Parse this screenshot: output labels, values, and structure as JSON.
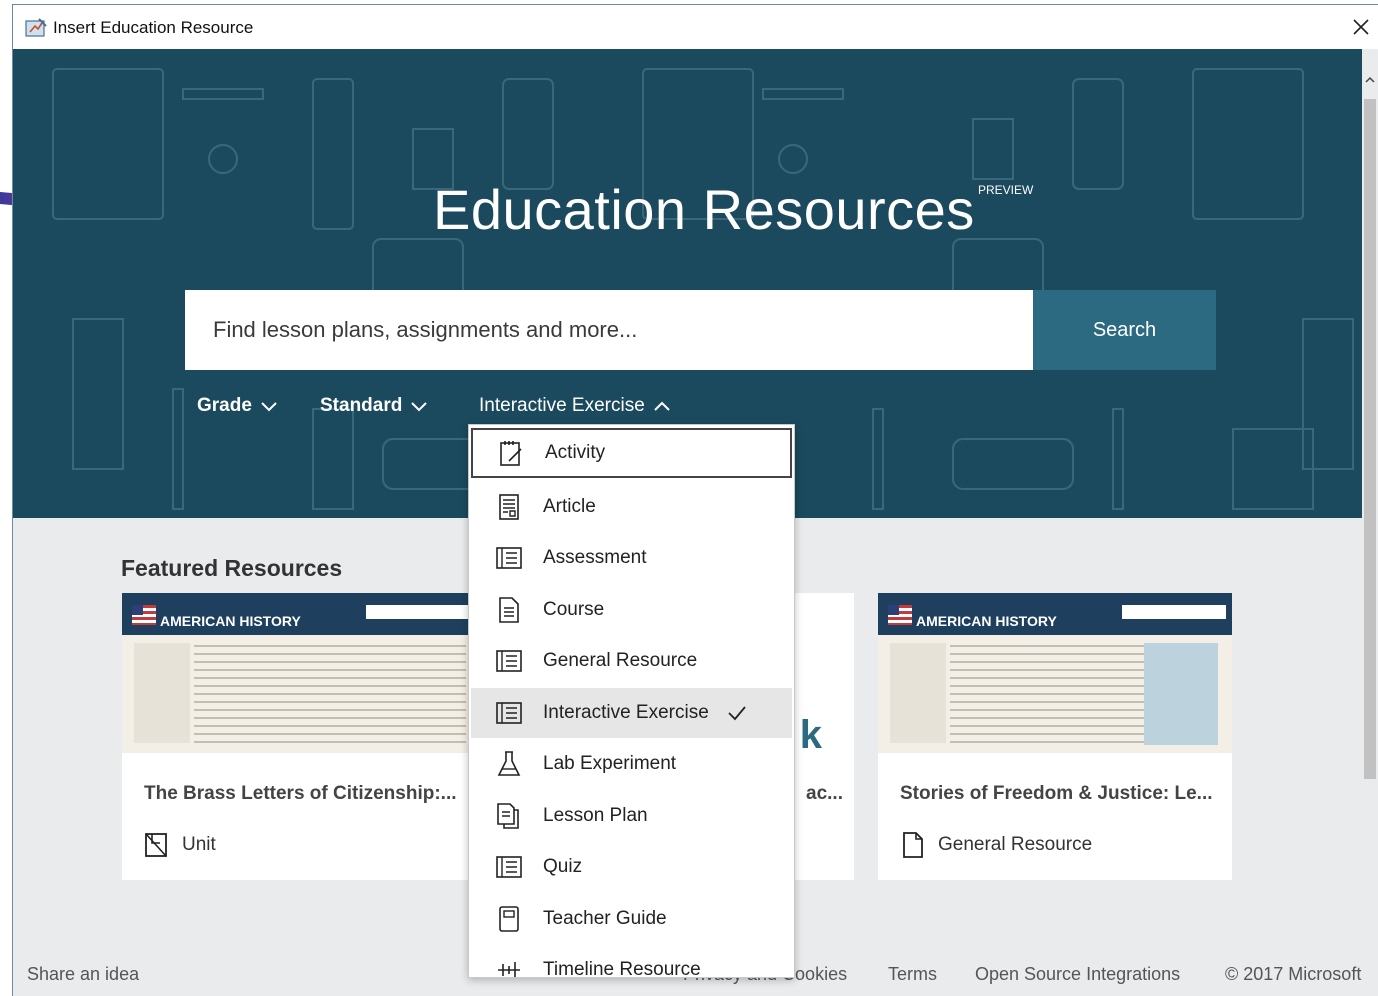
{
  "window": {
    "title": "Insert Education Resource"
  },
  "hero": {
    "title": "Education Resources",
    "badge": "PREVIEW"
  },
  "search": {
    "placeholder": "Find lesson plans, assignments and more...",
    "button_label": "Search"
  },
  "filters": [
    {
      "label": "Grade",
      "state": "collapsed"
    },
    {
      "label": "Standard",
      "state": "collapsed"
    },
    {
      "label": "Interactive Exercise",
      "state": "expanded"
    }
  ],
  "dropdown": {
    "items": [
      {
        "label": "Activity",
        "icon": "activity-icon"
      },
      {
        "label": "Article",
        "icon": "article-icon"
      },
      {
        "label": "Assessment",
        "icon": "assessment-icon"
      },
      {
        "label": "Course",
        "icon": "course-icon"
      },
      {
        "label": "General Resource",
        "icon": "general-resource-icon"
      },
      {
        "label": "Interactive Exercise",
        "icon": "interactive-exercise-icon",
        "selected": true
      },
      {
        "label": "Lab Experiment",
        "icon": "lab-experiment-icon"
      },
      {
        "label": "Lesson Plan",
        "icon": "lesson-plan-icon"
      },
      {
        "label": "Quiz",
        "icon": "quiz-icon"
      },
      {
        "label": "Teacher Guide",
        "icon": "teacher-guide-icon"
      },
      {
        "label": "Timeline Resource",
        "icon": "timeline-resource-icon"
      }
    ],
    "focused_index": 0,
    "selected_index": 5
  },
  "featured": {
    "heading": "Featured Resources",
    "cards": [
      {
        "title": "The Brass Letters of Citizenship:...",
        "type": "Unit",
        "thumb_logo": "AMERICAN HISTORY",
        "icon": "unit-icon"
      },
      {
        "title": "...ac...",
        "type": "",
        "thumb_logo": "",
        "icon": ""
      },
      {
        "title": "Stories of Freedom & Justice: Le...",
        "type": "General Resource",
        "thumb_logo": "AMERICAN HISTORY",
        "icon": "document-icon"
      }
    ]
  },
  "footer": {
    "share": "Share an idea",
    "privacy": "Privacy and Cookies",
    "terms": "Terms",
    "open_source": "Open Source Integrations",
    "copyright": "© 2017 Microsoft"
  },
  "colors": {
    "hero_bg": "#1b4a5e",
    "search_button": "#2b6a80",
    "page_bg": "#e9ebed"
  }
}
